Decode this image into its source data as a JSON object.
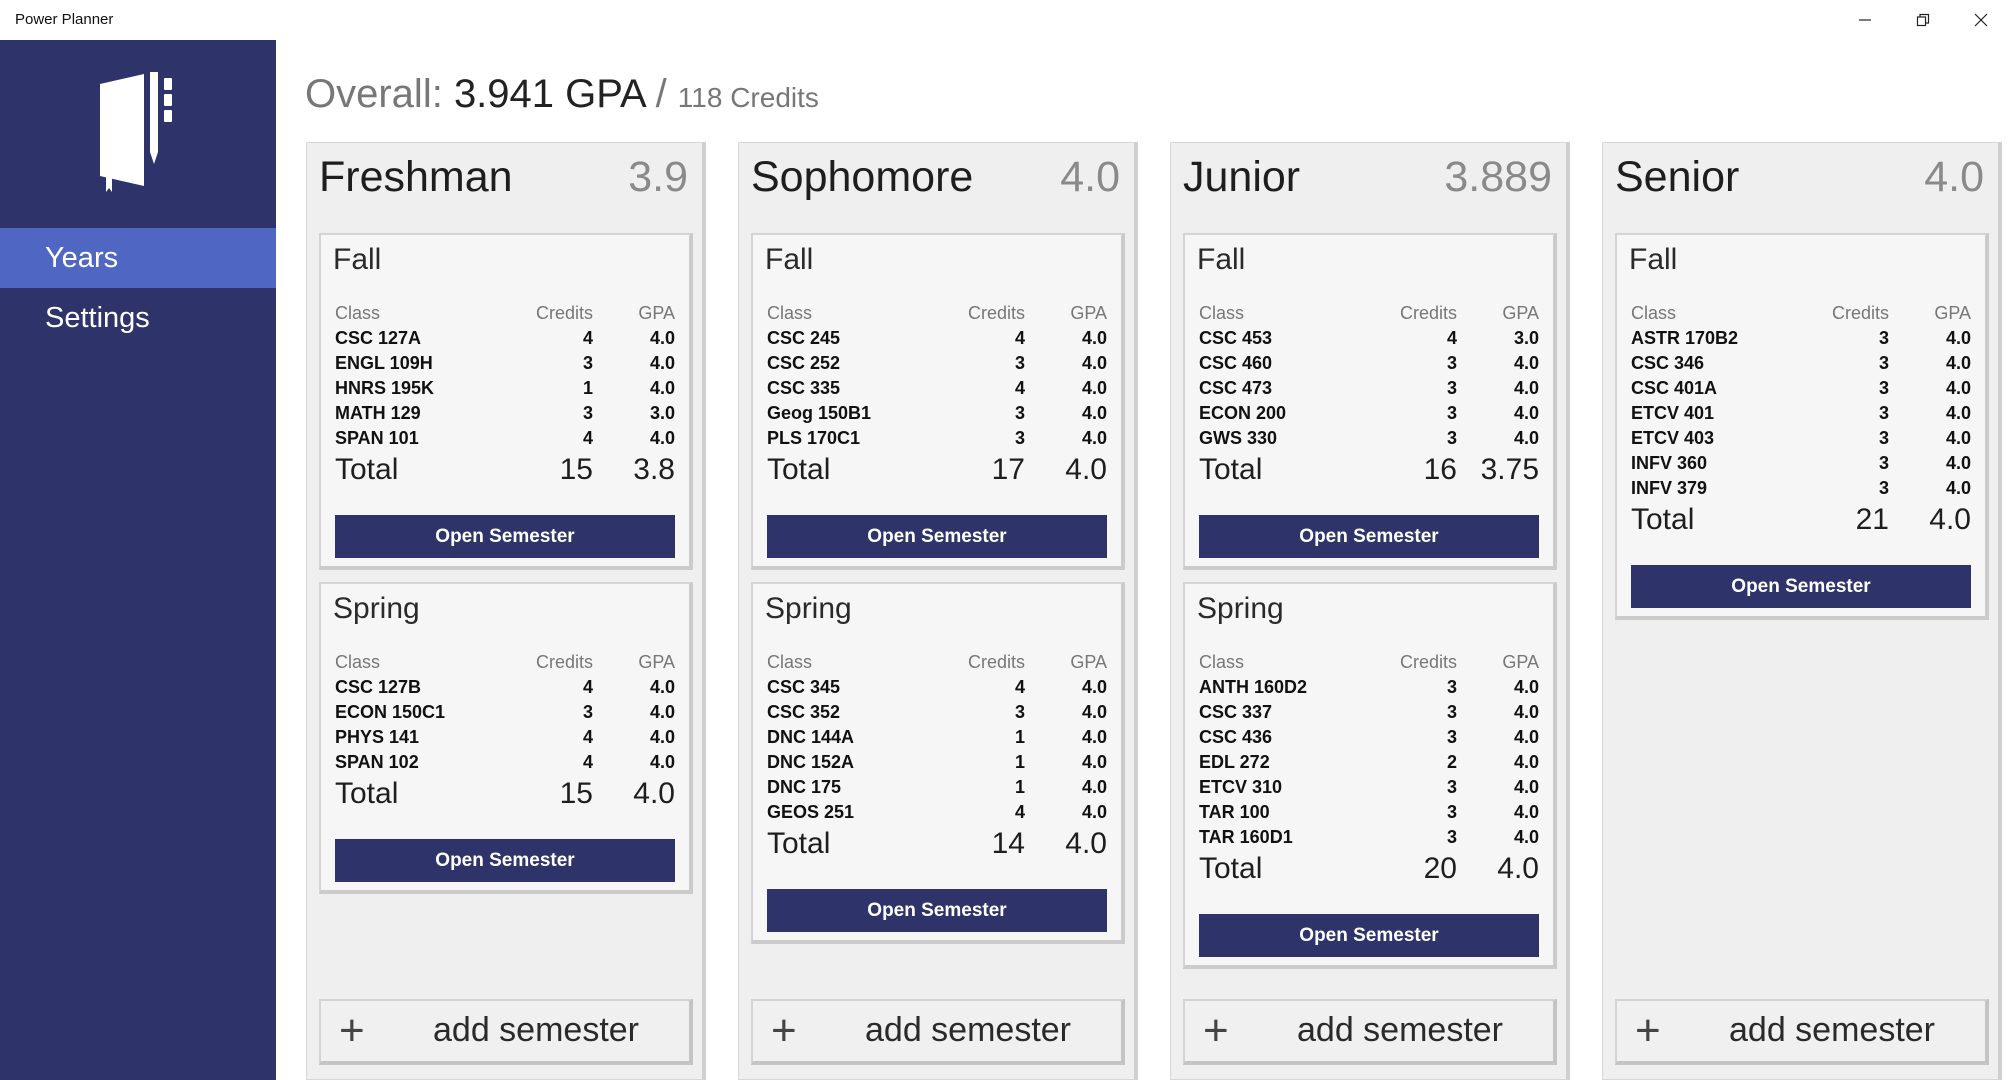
{
  "window": {
    "title": "Power Planner",
    "minimize_icon": "minimize-icon",
    "maximize_icon": "restore-icon",
    "close_icon": "close-icon"
  },
  "sidebar": {
    "logo_icon": "notebook-pen-logo",
    "items": [
      {
        "label": "Years",
        "selected": true
      },
      {
        "label": "Settings",
        "selected": false
      }
    ]
  },
  "header": {
    "prefix": "Overall: ",
    "gpa": "3.941 GPA",
    "separator": " / ",
    "credits": "118 Credits"
  },
  "labels": {
    "class_header": "Class",
    "credits_header": "Credits",
    "gpa_header": "GPA",
    "total_label": "Total",
    "open_semester": "Open Semester",
    "add_semester": "add semester",
    "add_icon": "+"
  },
  "colors": {
    "sidebar": "#2e3369",
    "nav_selected": "#4f67c3",
    "button": "#2e3369"
  },
  "years": [
    {
      "name": "Freshman",
      "gpa": "3.9",
      "semesters": [
        {
          "name": "Fall",
          "total_credits": "15",
          "total_gpa": "3.8",
          "classes": [
            {
              "class": "CSC 127A",
              "credits": "4",
              "gpa": "4.0"
            },
            {
              "class": "ENGL 109H",
              "credits": "3",
              "gpa": "4.0"
            },
            {
              "class": "HNRS 195K",
              "credits": "1",
              "gpa": "4.0"
            },
            {
              "class": "MATH 129",
              "credits": "3",
              "gpa": "3.0"
            },
            {
              "class": "SPAN 101",
              "credits": "4",
              "gpa": "4.0"
            }
          ]
        },
        {
          "name": "Spring",
          "total_credits": "15",
          "total_gpa": "4.0",
          "classes": [
            {
              "class": "CSC 127B",
              "credits": "4",
              "gpa": "4.0"
            },
            {
              "class": "ECON 150C1",
              "credits": "3",
              "gpa": "4.0"
            },
            {
              "class": "PHYS 141",
              "credits": "4",
              "gpa": "4.0"
            },
            {
              "class": "SPAN 102",
              "credits": "4",
              "gpa": "4.0"
            }
          ]
        }
      ]
    },
    {
      "name": "Sophomore",
      "gpa": "4.0",
      "semesters": [
        {
          "name": "Fall",
          "total_credits": "17",
          "total_gpa": "4.0",
          "classes": [
            {
              "class": "CSC 245",
              "credits": "4",
              "gpa": "4.0"
            },
            {
              "class": "CSC 252",
              "credits": "3",
              "gpa": "4.0"
            },
            {
              "class": "CSC 335",
              "credits": "4",
              "gpa": "4.0"
            },
            {
              "class": "Geog 150B1",
              "credits": "3",
              "gpa": "4.0"
            },
            {
              "class": "PLS 170C1",
              "credits": "3",
              "gpa": "4.0"
            }
          ]
        },
        {
          "name": "Spring",
          "total_credits": "14",
          "total_gpa": "4.0",
          "classes": [
            {
              "class": "CSC 345",
              "credits": "4",
              "gpa": "4.0"
            },
            {
              "class": "CSC 352",
              "credits": "3",
              "gpa": "4.0"
            },
            {
              "class": "DNC 144A",
              "credits": "1",
              "gpa": "4.0"
            },
            {
              "class": "DNC 152A",
              "credits": "1",
              "gpa": "4.0"
            },
            {
              "class": "DNC 175",
              "credits": "1",
              "gpa": "4.0"
            },
            {
              "class": "GEOS 251",
              "credits": "4",
              "gpa": "4.0"
            }
          ]
        }
      ]
    },
    {
      "name": "Junior",
      "gpa": "3.889",
      "semesters": [
        {
          "name": "Fall",
          "total_credits": "16",
          "total_gpa": "3.75",
          "classes": [
            {
              "class": "CSC 453",
              "credits": "4",
              "gpa": "3.0"
            },
            {
              "class": "CSC 460",
              "credits": "3",
              "gpa": "4.0"
            },
            {
              "class": "CSC 473",
              "credits": "3",
              "gpa": "4.0"
            },
            {
              "class": "ECON 200",
              "credits": "3",
              "gpa": "4.0"
            },
            {
              "class": "GWS 330",
              "credits": "3",
              "gpa": "4.0"
            }
          ]
        },
        {
          "name": "Spring",
          "total_credits": "20",
          "total_gpa": "4.0",
          "classes": [
            {
              "class": "ANTH 160D2",
              "credits": "3",
              "gpa": "4.0"
            },
            {
              "class": "CSC 337",
              "credits": "3",
              "gpa": "4.0"
            },
            {
              "class": "CSC 436",
              "credits": "3",
              "gpa": "4.0"
            },
            {
              "class": "EDL 272",
              "credits": "2",
              "gpa": "4.0"
            },
            {
              "class": "ETCV 310",
              "credits": "3",
              "gpa": "4.0"
            },
            {
              "class": "TAR 100",
              "credits": "3",
              "gpa": "4.0"
            },
            {
              "class": "TAR 160D1",
              "credits": "3",
              "gpa": "4.0"
            }
          ]
        }
      ]
    },
    {
      "name": "Senior",
      "gpa": "4.0",
      "semesters": [
        {
          "name": "Fall",
          "total_credits": "21",
          "total_gpa": "4.0",
          "classes": [
            {
              "class": "ASTR 170B2",
              "credits": "3",
              "gpa": "4.0"
            },
            {
              "class": "CSC 346",
              "credits": "3",
              "gpa": "4.0"
            },
            {
              "class": "CSC 401A",
              "credits": "3",
              "gpa": "4.0"
            },
            {
              "class": "ETCV 401",
              "credits": "3",
              "gpa": "4.0"
            },
            {
              "class": "ETCV 403",
              "credits": "3",
              "gpa": "4.0"
            },
            {
              "class": "INFV 360",
              "credits": "3",
              "gpa": "4.0"
            },
            {
              "class": "INFV 379",
              "credits": "3",
              "gpa": "4.0"
            }
          ]
        }
      ]
    }
  ]
}
